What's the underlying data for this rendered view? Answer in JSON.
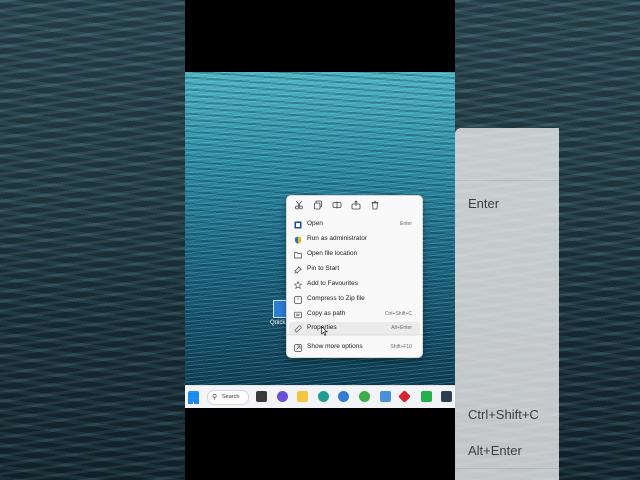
{
  "context_menu": {
    "toolbar": [
      "cut-icon",
      "copy-icon",
      "rename-icon",
      "share-icon",
      "delete-icon"
    ],
    "items": [
      {
        "label": "Open",
        "shortcut": "Enter",
        "icon": "app-icon"
      },
      {
        "label": "Run as administrator",
        "shortcut": "",
        "icon": "shield-icon"
      },
      {
        "label": "Open file location",
        "shortcut": "",
        "icon": "folder-icon"
      },
      {
        "label": "Pin to Start",
        "shortcut": "",
        "icon": "pin-icon"
      },
      {
        "label": "Add to Favourites",
        "shortcut": "",
        "icon": "star-icon"
      },
      {
        "label": "Compress to Zip file",
        "shortcut": "",
        "icon": "zip-icon"
      },
      {
        "label": "Copy as path",
        "shortcut": "Ctrl+Shift+C",
        "icon": "path-icon"
      },
      {
        "label": "Properties",
        "shortcut": "Alt+Enter",
        "icon": "wrench-icon"
      },
      {
        "label": "Show more options",
        "shortcut": "Shift+F10",
        "icon": "more-options-icon"
      }
    ]
  },
  "desktop": {
    "icon_label": "Quick..."
  },
  "taskbar": {
    "search_label": "Search",
    "icons": [
      "start-icon",
      "search-icon",
      "task-view-icon",
      "chat-icon",
      "explorer-icon",
      "edge-icon",
      "browser-icon",
      "chrome-icon",
      "notes-icon",
      "app-red-icon",
      "app-green-icon",
      "store-icon"
    ]
  },
  "background_ghost": {
    "shortcuts": [
      "Enter",
      "Ctrl+Shift+C",
      "Alt+Enter"
    ]
  }
}
